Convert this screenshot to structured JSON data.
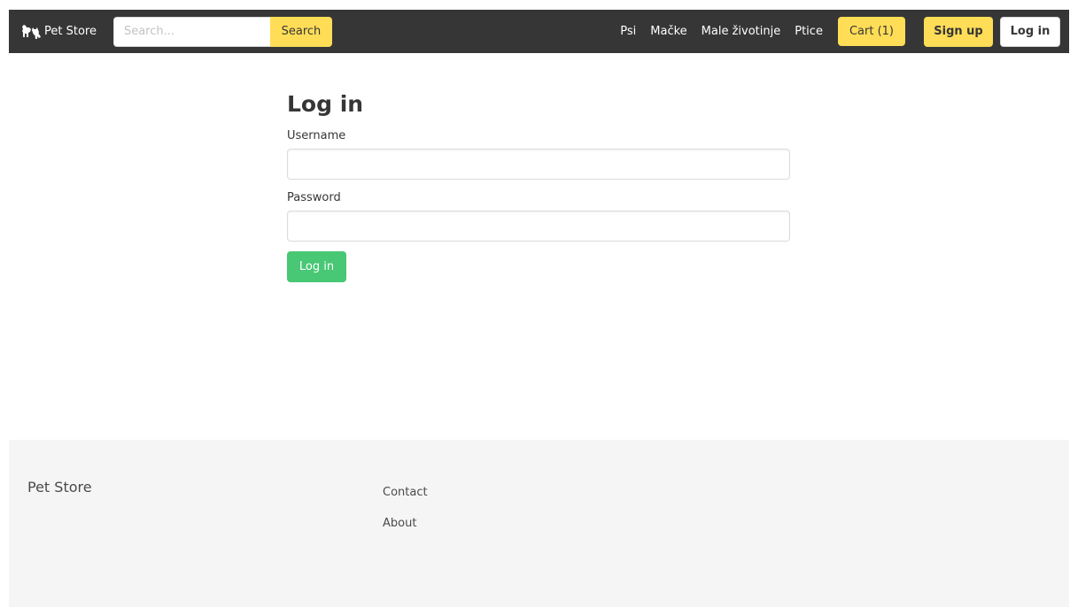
{
  "navbar": {
    "brand_icon": "cat-and-dog-logo-icon",
    "brand_label": "Pet Store",
    "search": {
      "placeholder": "Search...",
      "value": "",
      "button_label": "Search"
    },
    "links": [
      {
        "label": "Psi"
      },
      {
        "label": "Mačke"
      },
      {
        "label": "Male životinje"
      },
      {
        "label": "Ptice"
      }
    ],
    "cart_label": "Cart (1)",
    "signup_label": "Sign up",
    "login_label": "Log in",
    "colors": {
      "background": "#363636",
      "accent": "#ffdd57"
    }
  },
  "main": {
    "title": "Log in",
    "username": {
      "label": "Username",
      "value": ""
    },
    "password": {
      "label": "Password",
      "value": ""
    },
    "submit_label": "Log in",
    "colors": {
      "submit": "#48c774"
    }
  },
  "footer": {
    "brand": "Pet Store",
    "links": [
      {
        "label": "Contact"
      },
      {
        "label": "About"
      }
    ],
    "colors": {
      "background": "#f5f5f5"
    }
  }
}
